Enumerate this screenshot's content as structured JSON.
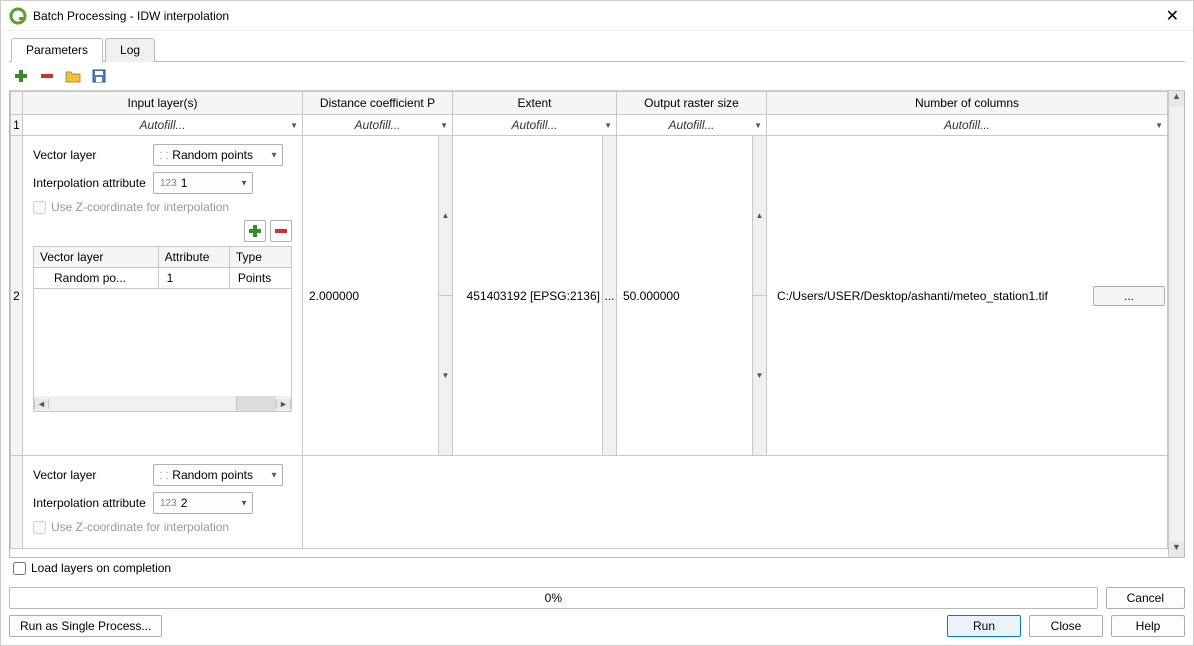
{
  "window": {
    "title": "Batch Processing - IDW interpolation"
  },
  "tabs": {
    "parameters": "Parameters",
    "log": "Log"
  },
  "columns": {
    "input_layer": "Input layer(s)",
    "distance_coef": "Distance coefficient P",
    "extent": "Extent",
    "raster_size": "Output raster size",
    "num_columns": "Number of columns"
  },
  "autofill": "Autofill...",
  "row1": {
    "vector_layer_label": "Vector layer",
    "vector_layer_value": "Random points",
    "interp_attr_label": "Interpolation attribute",
    "interp_attr_prefix": "123",
    "interp_attr_value": "1",
    "use_z_label": "Use Z-coordinate for interpolation",
    "inner_headers": {
      "layer": "Vector layer",
      "attr": "Attribute",
      "type": "Type"
    },
    "inner_row": {
      "layer": "Random po...",
      "attr": "1",
      "type": "Points"
    },
    "distance": "2.000000",
    "extent": "451403192 [EPSG:2136]",
    "raster_size": "50.000000",
    "num_cols": "C:/Users/USER/Desktop/ashanti/meteo_station1.tif",
    "browse": "..."
  },
  "row2": {
    "vector_layer_label": "Vector layer",
    "vector_layer_value": "Random points",
    "interp_attr_label": "Interpolation attribute",
    "interp_attr_prefix": "123",
    "interp_attr_value": "2",
    "use_z_label": "Use Z-coordinate for interpolation"
  },
  "row_numbers": {
    "r1": "1",
    "r2": "2"
  },
  "load_layers": "Load layers on completion",
  "progress": "0%",
  "buttons": {
    "cancel": "Cancel",
    "run_single": "Run as Single Process...",
    "run": "Run",
    "close": "Close",
    "help": "Help"
  },
  "ellipsis": "..."
}
